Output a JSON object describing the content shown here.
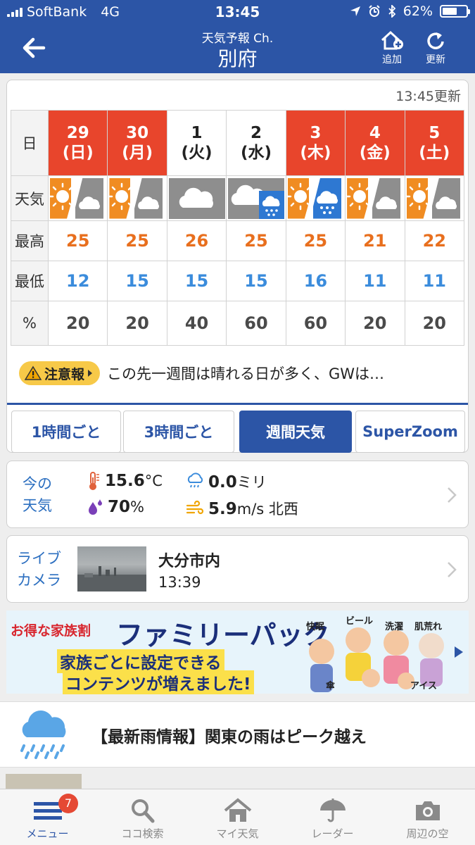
{
  "status_bar": {
    "carrier": "SoftBank",
    "network": "4G",
    "time": "13:45",
    "battery": "62%"
  },
  "header": {
    "subtitle": "天気予報 Ch.",
    "title": "別府",
    "add_label": "追加",
    "refresh_label": "更新"
  },
  "weekly": {
    "updated": "13:45更新",
    "row_labels": {
      "day": "日",
      "weather": "天気",
      "high": "最高",
      "low": "最低",
      "precip": "%"
    },
    "days": [
      {
        "date": "29",
        "weekday": "(日)",
        "holiday": true,
        "weather": "sunny-cloudy-icon",
        "high": "25",
        "low": "12",
        "precip": "20"
      },
      {
        "date": "30",
        "weekday": "(月)",
        "holiday": true,
        "weather": "sunny-cloudy-icon",
        "high": "25",
        "low": "15",
        "precip": "20"
      },
      {
        "date": "1",
        "weekday": "(火)",
        "holiday": false,
        "weather": "cloudy-icon",
        "high": "26",
        "low": "15",
        "precip": "40"
      },
      {
        "date": "2",
        "weekday": "(水)",
        "holiday": false,
        "weather": "cloudy-rain-icon",
        "high": "25",
        "low": "15",
        "precip": "60"
      },
      {
        "date": "3",
        "weekday": "(木)",
        "holiday": true,
        "weather": "sunny-rain-icon",
        "high": "25",
        "low": "16",
        "precip": "60"
      },
      {
        "date": "4",
        "weekday": "(金)",
        "holiday": true,
        "weather": "sunny-cloudy-icon",
        "high": "21",
        "low": "11",
        "precip": "20"
      },
      {
        "date": "5",
        "weekday": "(土)",
        "holiday": true,
        "weather": "sunny-cloudy-icon",
        "high": "22",
        "low": "11",
        "precip": "20"
      }
    ],
    "notice_label": "注意報",
    "notice_text": "この先一週間は晴れる日が多く、GWは…",
    "tabs": [
      {
        "label": "1時間ごと",
        "active": false
      },
      {
        "label": "3時間ごと",
        "active": false
      },
      {
        "label": "週間天気",
        "active": true
      },
      {
        "label": "SuperZoom",
        "active": false
      }
    ]
  },
  "current": {
    "label_line1": "今の",
    "label_line2": "天気",
    "temp": "15.6",
    "temp_unit": "°C",
    "rain": "0.0",
    "rain_unit": "ミリ",
    "humidity": "70",
    "humidity_unit": "%",
    "wind": "5.9",
    "wind_unit": "m/s 北西"
  },
  "live_camera": {
    "label_line1": "ライブ",
    "label_line2": "カメラ",
    "location": "大分市内",
    "time": "13:39"
  },
  "banner": {
    "tag": "お得な家族割",
    "title": "ファミリーパック",
    "line1": "家族ごとに設定できる",
    "line2": "コンテンツが増えました!",
    "bubbles": [
      "快眠",
      "ビール",
      "洗濯",
      "肌荒れ",
      "傘",
      "アイス"
    ]
  },
  "news": {
    "text": "【最新雨情報】関東の雨はピーク越え"
  },
  "tabbar": {
    "badge": "7",
    "items": [
      {
        "label": "メニュー",
        "icon": "menu-icon",
        "active": true
      },
      {
        "label": "ココ検索",
        "icon": "search-icon",
        "active": false
      },
      {
        "label": "マイ天気",
        "icon": "home-icon",
        "active": false
      },
      {
        "label": "レーダー",
        "icon": "umbrella-icon",
        "active": false
      },
      {
        "label": "周辺の空",
        "icon": "camera-icon",
        "active": false
      }
    ]
  },
  "colors": {
    "brand": "#2c55a6",
    "holiday": "#e8452c",
    "high": "#e86f1e",
    "low": "#3b8cdc",
    "notice": "#f7c948"
  }
}
